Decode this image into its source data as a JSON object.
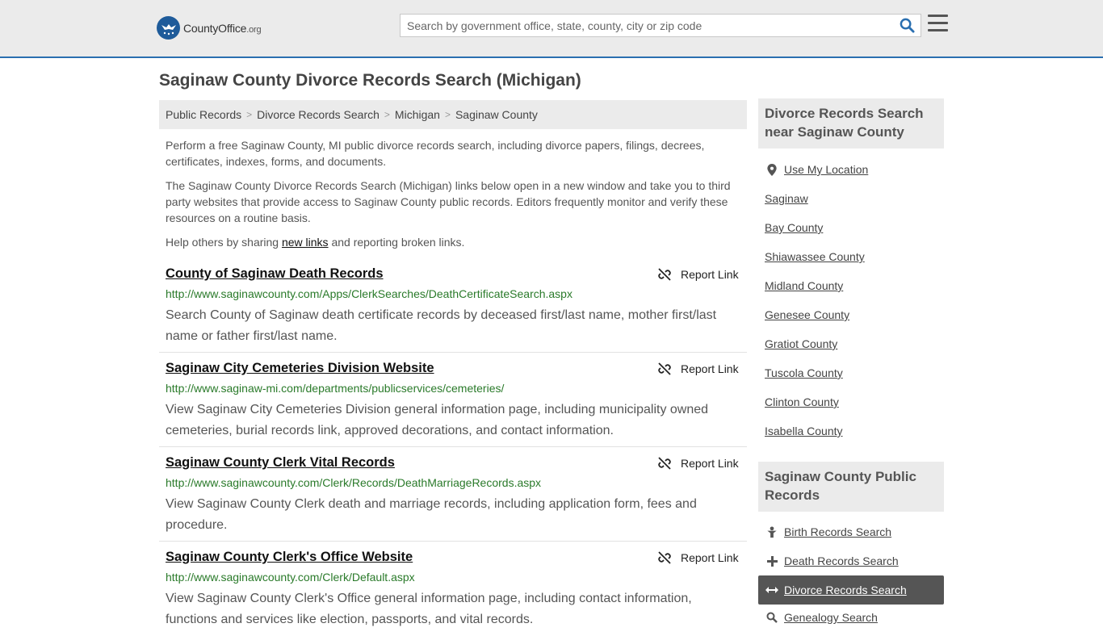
{
  "header": {
    "logo_text": "CountyOffice",
    "logo_suffix": ".org",
    "search_placeholder": "Search by government office, state, county, city or zip code"
  },
  "page_title": "Saginaw County Divorce Records Search (Michigan)",
  "breadcrumb": [
    "Public Records",
    "Divorce Records Search",
    "Michigan",
    "Saginaw County"
  ],
  "intro": {
    "p1": "Perform a free Saginaw County, MI public divorce records search, including divorce papers, filings, decrees, certificates, indexes, forms, and documents.",
    "p2": "The Saginaw County Divorce Records Search (Michigan) links below open in a new window and take you to third party websites that provide access to Saginaw County public records. Editors frequently monitor and verify these resources on a routine basis.",
    "p3_before": "Help others by sharing ",
    "p3_link": "new links",
    "p3_after": " and reporting broken links."
  },
  "report_label": "Report Link",
  "results": [
    {
      "title": "County of Saginaw Death Records",
      "url": "http://www.saginawcounty.com/Apps/ClerkSearches/DeathCertificateSearch.aspx",
      "desc": "Search County of Saginaw death certificate records by deceased first/last name, mother first/last name or father first/last name."
    },
    {
      "title": "Saginaw City Cemeteries Division Website",
      "url": "http://www.saginaw-mi.com/departments/publicservices/cemeteries/",
      "desc": "View Saginaw City Cemeteries Division general information page, including municipality owned cemeteries, burial records link, approved decorations, and contact information."
    },
    {
      "title": "Saginaw County Clerk Vital Records",
      "url": "http://www.saginawcounty.com/Clerk/Records/DeathMarriageRecords.aspx",
      "desc": "View Saginaw County Clerk death and marriage records, including application form, fees and procedure."
    },
    {
      "title": "Saginaw County Clerk's Office Website",
      "url": "http://www.saginawcounty.com/Clerk/Default.aspx",
      "desc": "View Saginaw County Clerk's Office general information page, including contact information, functions and services like election, passports, and vital records."
    }
  ],
  "sidebar": {
    "nearby_heading": "Divorce Records Search near Saginaw County",
    "use_location": "Use My Location",
    "nearby": [
      "Saginaw",
      "Bay County",
      "Shiawassee County",
      "Midland County",
      "Genesee County",
      "Gratiot County",
      "Tuscola County",
      "Clinton County",
      "Isabella County"
    ],
    "public_heading": "Saginaw County Public Records",
    "public_links": [
      {
        "label": "Birth Records Search",
        "icon": "baby-icon"
      },
      {
        "label": "Death Records Search",
        "icon": "cross-icon"
      },
      {
        "label": "Divorce Records Search",
        "icon": "split-arrows-icon"
      },
      {
        "label": "Genealogy Search",
        "icon": "search-icon"
      }
    ]
  },
  "colors": {
    "header_bg": "#ebebeb",
    "accent_blue": "#2a6fb0",
    "url_green": "#2a7a2a",
    "active_bg": "#555555"
  }
}
